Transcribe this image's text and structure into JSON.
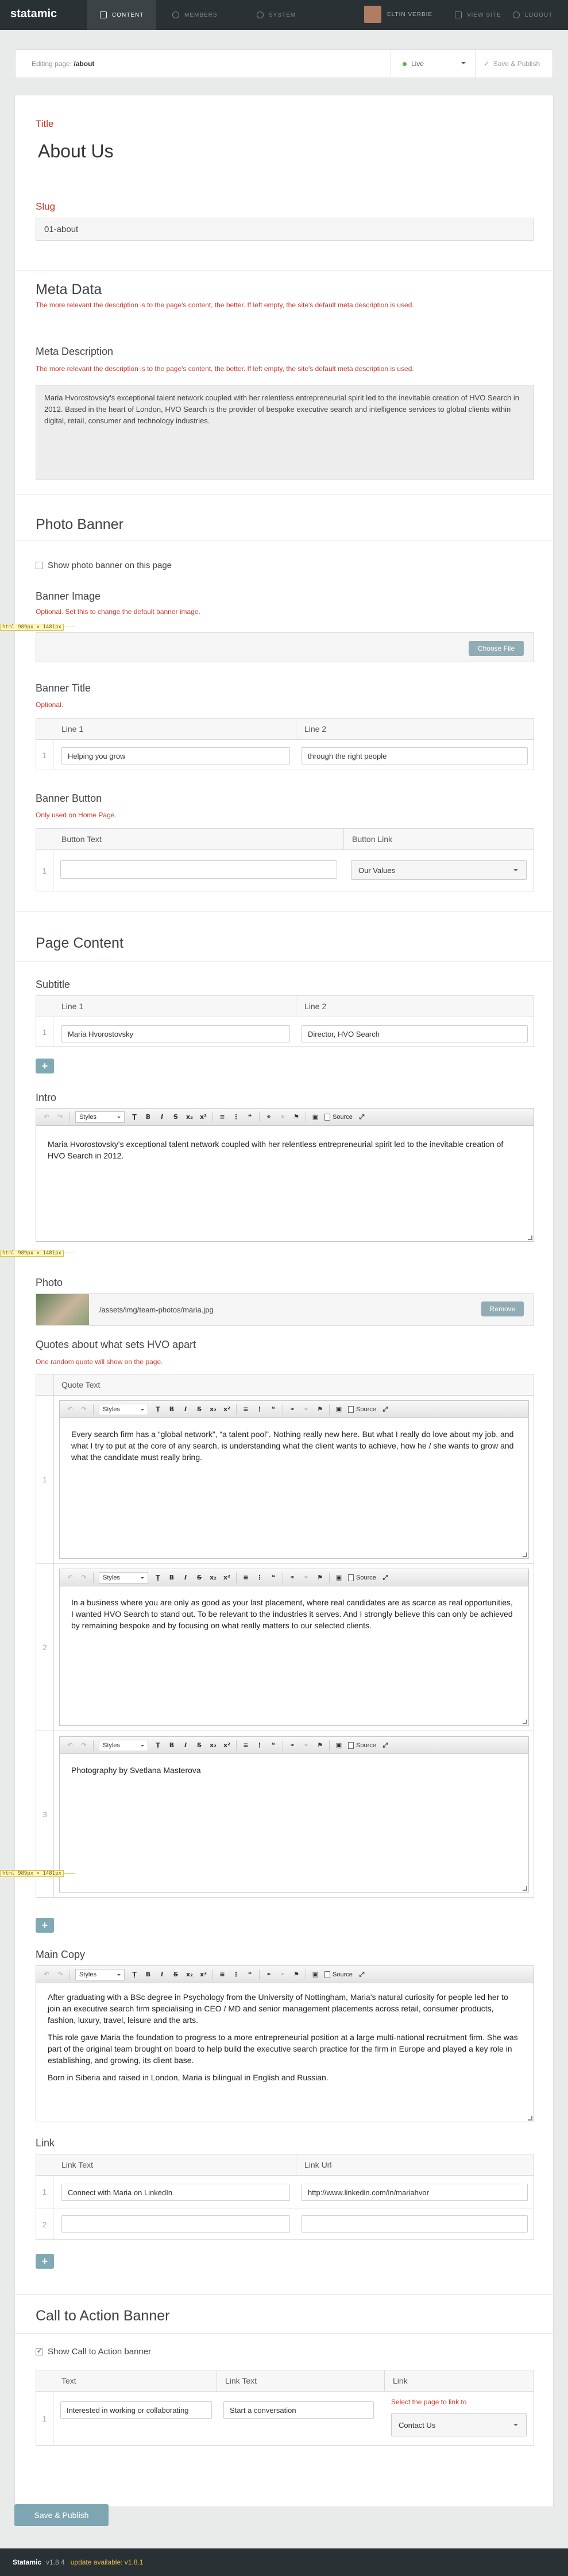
{
  "app": {
    "logo": "statamic",
    "nav": {
      "content": "Content",
      "members": "Members",
      "system": "System"
    },
    "user": "Eltin Verbie",
    "view_site": "View Site",
    "logout": "Logout"
  },
  "subbar": {
    "editing_label": "Editing page:",
    "page_path": "/about",
    "status": "Live",
    "save": "Save & Publish"
  },
  "title_section": {
    "title_label": "Title",
    "title_value": "About Us",
    "slug_label": "Slug",
    "slug_value": "01-about"
  },
  "meta": {
    "heading": "Meta Data",
    "hint": "The more relevant the description is to the page's content, the better. If left empty, the site's default meta description is used.",
    "desc_label": "Meta Description",
    "desc_value": "Maria Hvorostovsky's exceptional talent network coupled with her relentless entrepreneurial spirit led to the inevitable creation of HVO Search in 2012. Based in the heart of London, HVO Search is the provider of bespoke executive search and intelligence services to global clients within digital, retail, consumer and technology industries."
  },
  "photo_banner": {
    "heading": "Photo Banner",
    "show_label": "Show photo banner on this page",
    "image_label": "Banner Image",
    "image_hint": "Optional. Set this to change the default banner image.",
    "choose": "Choose File",
    "title_label": "Banner Title",
    "title_hint": "Optional.",
    "col1": "Line 1",
    "col2": "Line 2",
    "row_num": "1",
    "line1": "Helping you grow",
    "line2": "through the right people",
    "button_label": "Banner Button",
    "button_hint": "Only used on Home Page.",
    "btn_col1": "Button Text",
    "btn_col2": "Button Link",
    "btn_text": "",
    "btn_link": "Our Values"
  },
  "rulers": [
    "html 989px × 1481px",
    "html 989px × 1481px",
    "html 989px × 1481px"
  ],
  "page_content": {
    "heading": "Page Content",
    "subtitle_label": "Subtitle",
    "col1": "Line 1",
    "col2": "Line 2",
    "row_num": "1",
    "line1": "Maria Hvorostovsky",
    "line2": "Director, HVO Search",
    "add": "+",
    "intro_label": "Intro",
    "intro_text": "Maria Hvorostovsky's exceptional talent network coupled with her relentless entrepreneurial spirit led to the inevitable creation of HVO Search in 2012.",
    "photo_label": "Photo",
    "photo_path": "/assets/img/team-photos/maria.jpg",
    "remove": "Remove",
    "quotes_label": "Quotes about what sets HVO apart",
    "quotes_hint": "One random quote will show on the page.",
    "quote_col": "Quote Text",
    "quotes": [
      {
        "num": "1",
        "text": "Every search firm has a “global network”, “a talent pool”. Nothing really new here. But what I really do love about my job, and what I try to put at the core of any search, is understanding what the client wants to achieve, how he / she wants to grow and what the candidate must really bring."
      },
      {
        "num": "2",
        "text": "In a business where you are only as good as your last placement, where real candidates are as scarce as real opportunities, I wanted HVO Search to stand out. To be relevant to the industries it serves. And I strongly believe this can only be achieved by remaining bespoke and by focusing on what really matters to our selected clients."
      },
      {
        "num": "3",
        "text": "Photography by Svetlana Masterova"
      }
    ],
    "main_copy_label": "Main Copy",
    "main_copy": [
      "After graduating with a BSc degree in Psychology from the University of Nottingham, Maria's natural curiosity for people led her to join an executive search firm specialising in CEO / MD and senior management placements across retail, consumer products, fashion, luxury, travel, leisure and the arts.",
      "This role gave Maria the foundation to progress to a more entrepreneurial position at a large multi-national recruitment firm. She was part of the original team brought on board to help build the executive search practice for the firm in Europe and played a key role in establishing, and growing, its client base.",
      "Born in Siberia and raised in London, Maria is bilingual in English and Russian."
    ],
    "link_label": "Link",
    "link_col1": "Link Text",
    "link_col2": "Link Url",
    "links": [
      {
        "num": "1",
        "text": "Connect with Maria on LinkedIn",
        "url": "http://www.linkedin.com/in/mariahvor"
      },
      {
        "num": "2",
        "text": "",
        "url": ""
      }
    ],
    "toolbar": {
      "styles": "Styles",
      "source": "Source"
    }
  },
  "cta": {
    "heading": "Call to Action Banner",
    "show_label": "Show Call to Action banner",
    "col1": "Text",
    "col2": "Link Text",
    "col3": "Link",
    "row_num": "1",
    "text": "Interested in working or collaborating",
    "link_text": "Start a conversation",
    "link_hint": "Select the page to link to",
    "link": "Contact Us"
  },
  "save_publish": "Save & Publish",
  "footer": {
    "brand": "Statamic",
    "version": "v1.8.4",
    "update": "update available: v1.8.1"
  }
}
